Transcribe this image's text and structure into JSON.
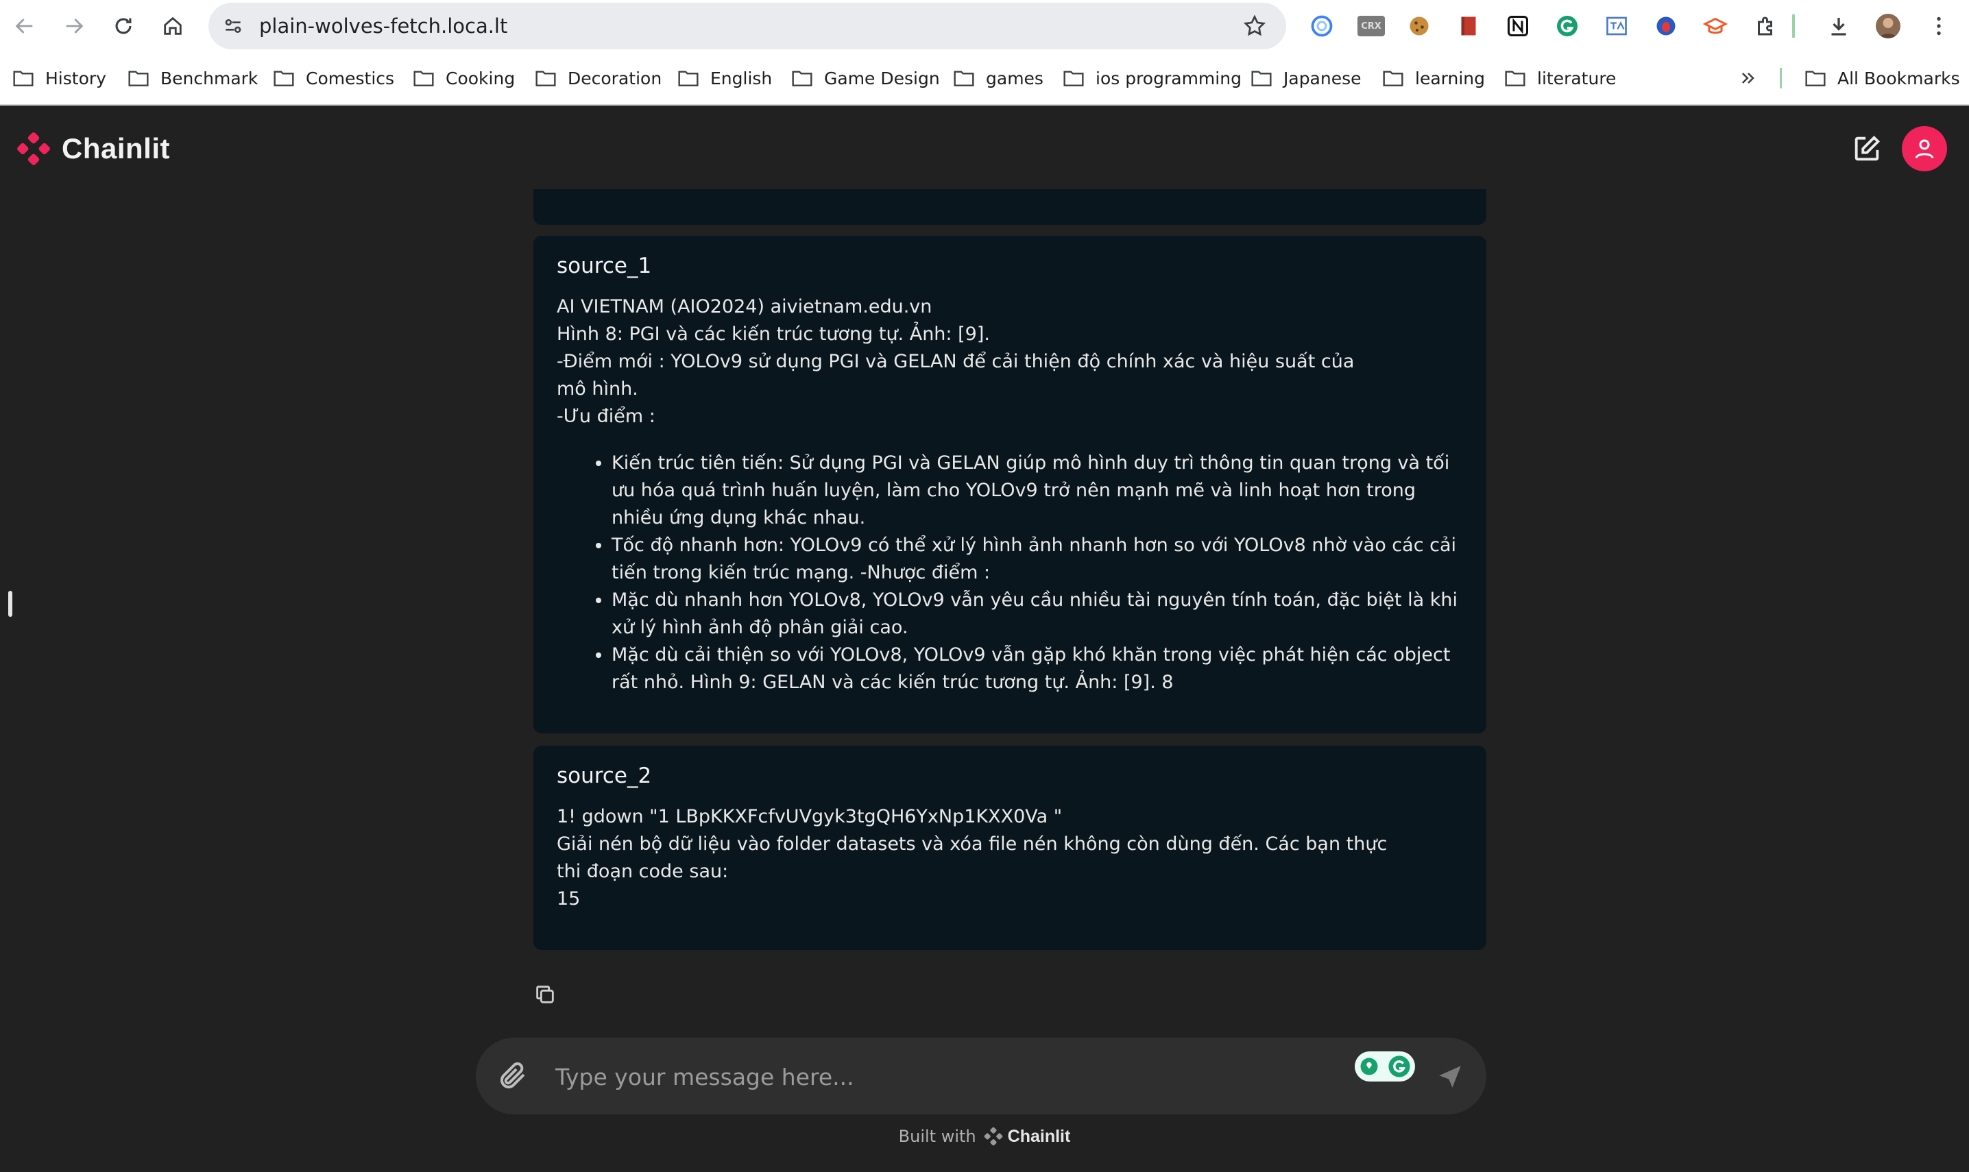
{
  "browser": {
    "url": "plain-wolves-fetch.loca.lt",
    "bookmarks": [
      "History",
      "Benchmark",
      "Comestics",
      "Cooking",
      "Decoration",
      "English",
      "Game Design",
      "games",
      "ios programming",
      "Japanese",
      "learning",
      "literature"
    ],
    "all_bookmarks": "All Bookmarks",
    "extension_crx": "CRX"
  },
  "app": {
    "name": "Chainlit",
    "accent": "#f0245b"
  },
  "messages": [
    {
      "title": "source_1",
      "lines": [
        "AI VIETNAM (AIO2024) aivietnam.edu.vn",
        "Hình 8: PGI và các kiến trúc tương tự. Ảnh: [9].",
        "-Điểm mới : YOLOv9 sử dụng PGI và GELAN để cải thiện độ chính xác và hiệu suất của",
        "mô hình.",
        "-Ưu điểm :"
      ],
      "bullets": [
        "Kiến trúc tiên tiến: Sử dụng PGI và GELAN giúp mô hình duy trì thông tin quan trọng và tối ưu hóa quá trình huấn luyện, làm cho YOLOv9 trở nên mạnh mẽ và linh hoạt hơn trong nhiều ứng dụng khác nhau.",
        "Tốc độ nhanh hơn: YOLOv9 có thể xử lý hình ảnh nhanh hơn so với YOLOv8 nhờ vào các cải tiến trong kiến trúc mạng. -Nhược điểm :",
        "Mặc dù nhanh hơn YOLOv8, YOLOv9 vẫn yêu cầu nhiều tài nguyên tính toán, đặc biệt là khi xử lý hình ảnh độ phân giải cao.",
        "Mặc dù cải thiện so với YOLOv8, YOLOv9 vẫn gặp khó khăn trong việc phát hiện các object rất nhỏ. Hình 9: GELAN và các kiến trúc tương tự. Ảnh: [9]. 8"
      ]
    },
    {
      "title": "source_2",
      "lines": [
        "1! gdown \"1 LBpKKXFcfvUVgyk3tgQH6YxNp1KXX0Va \"",
        "Giải nén bộ dữ liệu vào folder datasets và xóa file nén không còn dùng đến. Các bạn thực",
        "thi đoạn code sau:",
        "15"
      ]
    }
  ],
  "composer": {
    "placeholder": "Type your message here..."
  },
  "footer": {
    "built_with": "Built with",
    "brand": "Chainlit"
  }
}
